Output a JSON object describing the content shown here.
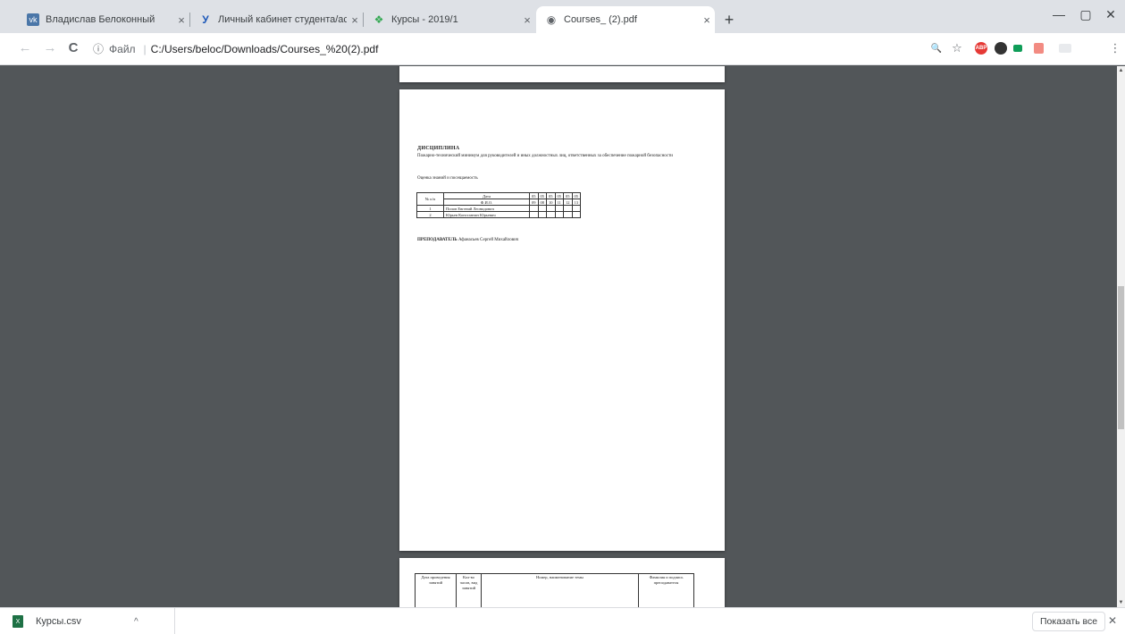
{
  "tabs": [
    {
      "title": "Владислав Белоконный",
      "icon": "vk-icon",
      "color": "#4a76a8",
      "glyph": "vk"
    },
    {
      "title": "Личный кабинет студента/асп",
      "icon": "university-icon",
      "color": "#ffffff",
      "glyph": "У"
    },
    {
      "title": "Курсы - 2019/1",
      "icon": "courses-icon",
      "color": "#ffffff",
      "glyph": "❖"
    },
    {
      "title": "Courses_ (2).pdf",
      "icon": "globe-icon",
      "color": "#ffffff",
      "glyph": "◉"
    }
  ],
  "tab_close_glyph": "×",
  "new_tab_glyph": "+",
  "window_controls": {
    "minimize": "—",
    "maximize": "▢",
    "close": "✕"
  },
  "toolbar": {
    "back": "←",
    "forward": "→",
    "reload": "C",
    "info_glyph": "ⓘ",
    "scheme": "Файл",
    "url": "C:/Users/beloc/Downloads/Courses_%20(2).pdf",
    "zoom_glyph": "🔍",
    "star_glyph": "☆",
    "menu_glyph": "⋮"
  },
  "document": {
    "heading": "ДИСЦИПЛИНА",
    "course": "Пожарно-технический минимум для руководителей и иных должностных лиц, ответственных за обеспечение пожарной безопасности",
    "grade_title": "Оценка знаний и посещаемость",
    "table": {
      "col_no": "№ п/п",
      "col_date": "Дата",
      "col_fio": "Ф.И.О.",
      "dates_top": [
        "05",
        "05",
        "05",
        "05",
        "05",
        "05"
      ],
      "dates_bottom": [
        "09",
        "08",
        "10",
        "11",
        "12",
        "13"
      ],
      "rows": [
        {
          "no": "1",
          "name": "Попов Евгений Леонидович"
        },
        {
          "no": "2",
          "name": "Юрьев Константин Юрьевич"
        }
      ]
    },
    "teacher_label": "ПРЕПОДАВАТЕЛЬ",
    "teacher_name": "Афанасьев Сергей Михайлович"
  },
  "next_page": {
    "col_date": "Дата проведения занятий",
    "col_hours": "Кол-во часов, вид занятий",
    "col_topic": "Номер, наименование темы",
    "col_teacher": "Фамилия и подпись преподавателя"
  },
  "downloads": {
    "file_name": "Курсы.csv",
    "file_icon_glyph": "X",
    "chevron": "^",
    "show_all": "Показать все",
    "close": "✕"
  }
}
